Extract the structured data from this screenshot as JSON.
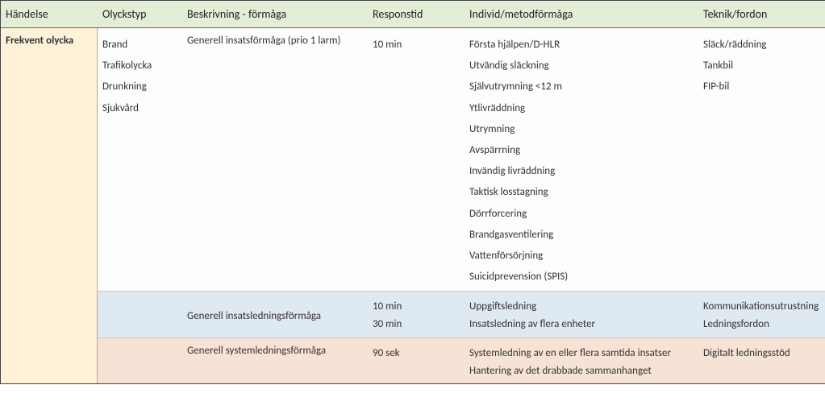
{
  "headers": {
    "handelse": "Händelse",
    "olyckstyp": "Olyckstyp",
    "beskrivning": "Beskrivning - förmåga",
    "responstid": "Responstid",
    "individ": "Individ/metodförmåga",
    "teknik": "Teknik/fordon"
  },
  "event_label": "Frekvent olycka",
  "olyckstyper": [
    "Brand",
    "Trafikolycka",
    "Drunkning",
    "Sjukvård"
  ],
  "sections": {
    "a": {
      "beskrivning": "Generell insatsförmåga (prio 1 larm)",
      "responstid": [
        "10 min"
      ],
      "individ": [
        "Första hjälpen/D-HLR",
        "Utvändig släckning",
        "Självutrymning <12 m",
        "Ytlivräddning",
        "Utrymning",
        "Avspärrning",
        "Invändig livräddning",
        "Taktisk losstagning",
        "Dörrforcering",
        "Brandgasventilering",
        "Vattenförsörjning",
        "Suicidprevension (SPIS)"
      ],
      "teknik": [
        "Släck/räddning",
        "Tankbil",
        "FIP-bil"
      ]
    },
    "b": {
      "beskrivning": "Generell insatsledningsförmåga",
      "responstid": [
        "10 min",
        "30 min"
      ],
      "individ": [
        "Uppgiftsledning",
        "Insatsledning av flera enheter"
      ],
      "teknik": [
        "Kommunikationsutrustning",
        "Ledningsfordon"
      ]
    },
    "c": {
      "beskrivning": "Generell systemledningsförmåga",
      "responstid": [
        "90 sek"
      ],
      "individ": [
        "Systemledning av en eller flera samtida insatser",
        "Hantering av det drabbade sammanhanget"
      ],
      "teknik": [
        "Digitalt ledningsstöd"
      ]
    }
  }
}
